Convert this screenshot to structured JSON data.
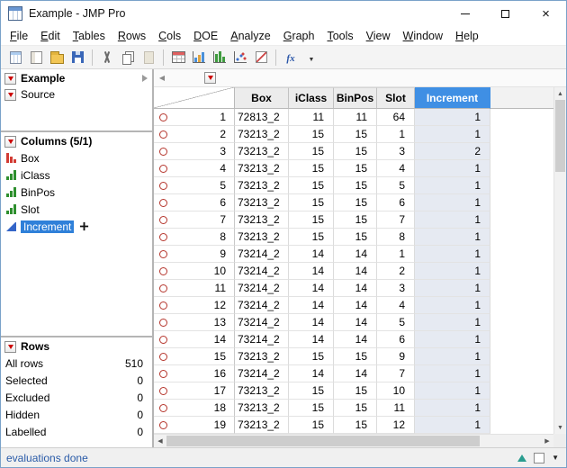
{
  "window": {
    "title": "Example - JMP Pro"
  },
  "menu": {
    "items": [
      "File",
      "Edit",
      "Tables",
      "Rows",
      "Cols",
      "DOE",
      "Analyze",
      "Graph",
      "Tools",
      "View",
      "Window",
      "Help"
    ]
  },
  "toolbar": {
    "icons": [
      "new-table",
      "journal",
      "open",
      "save",
      "divider",
      "cut",
      "copy",
      "paste",
      "divider",
      "data-table",
      "graph-builder",
      "distribution",
      "scatter",
      "profiler",
      "divider",
      "formula",
      "menu-caret"
    ],
    "disabled": [
      "paste"
    ]
  },
  "sidebar": {
    "table_panel": {
      "title": "Example",
      "items": [
        "Source"
      ]
    },
    "columns_panel": {
      "title": "Columns (5/1)",
      "items": [
        {
          "label": "Box",
          "type": "nominal",
          "selected": false
        },
        {
          "label": "iClass",
          "type": "ordinal",
          "selected": false
        },
        {
          "label": "BinPos",
          "type": "ordinal",
          "selected": false
        },
        {
          "label": "Slot",
          "type": "ordinal",
          "selected": false
        },
        {
          "label": "Increment",
          "type": "continuous",
          "selected": true
        }
      ]
    },
    "rows_panel": {
      "title": "Rows",
      "stats": [
        {
          "label": "All rows",
          "value": "510"
        },
        {
          "label": "Selected",
          "value": "0"
        },
        {
          "label": "Excluded",
          "value": "0"
        },
        {
          "label": "Hidden",
          "value": "0"
        },
        {
          "label": "Labelled",
          "value": "0"
        }
      ]
    }
  },
  "table": {
    "columns": [
      "Box",
      "iClass",
      "BinPos",
      "Slot",
      "Increment"
    ],
    "selected_column": "Increment",
    "rows": [
      [
        1,
        "72813_2",
        11,
        11,
        64,
        1
      ],
      [
        2,
        "73213_2",
        15,
        15,
        1,
        1
      ],
      [
        3,
        "73213_2",
        15,
        15,
        3,
        2
      ],
      [
        4,
        "73213_2",
        15,
        15,
        4,
        1
      ],
      [
        5,
        "73213_2",
        15,
        15,
        5,
        1
      ],
      [
        6,
        "73213_2",
        15,
        15,
        6,
        1
      ],
      [
        7,
        "73213_2",
        15,
        15,
        7,
        1
      ],
      [
        8,
        "73213_2",
        15,
        15,
        8,
        1
      ],
      [
        9,
        "73214_2",
        14,
        14,
        1,
        1
      ],
      [
        10,
        "73214_2",
        14,
        14,
        2,
        1
      ],
      [
        11,
        "73214_2",
        14,
        14,
        3,
        1
      ],
      [
        12,
        "73214_2",
        14,
        14,
        4,
        1
      ],
      [
        13,
        "73214_2",
        14,
        14,
        5,
        1
      ],
      [
        14,
        "73214_2",
        14,
        14,
        6,
        1
      ],
      [
        15,
        "73213_2",
        15,
        15,
        9,
        1
      ],
      [
        16,
        "73214_2",
        14,
        14,
        7,
        1
      ],
      [
        17,
        "73213_2",
        15,
        15,
        10,
        1
      ],
      [
        18,
        "73213_2",
        15,
        15,
        11,
        1
      ],
      [
        19,
        "73213_2",
        15,
        15,
        12,
        1
      ]
    ]
  },
  "status_bar": {
    "text": "evaluations done"
  },
  "colors": {
    "selection_blue": "#3f8fe4",
    "selected_column_tint": "#e6eaf2",
    "marker_red": "#b5352c",
    "red_triangle": "#cc0000",
    "status_text": "#2a5ba8"
  }
}
